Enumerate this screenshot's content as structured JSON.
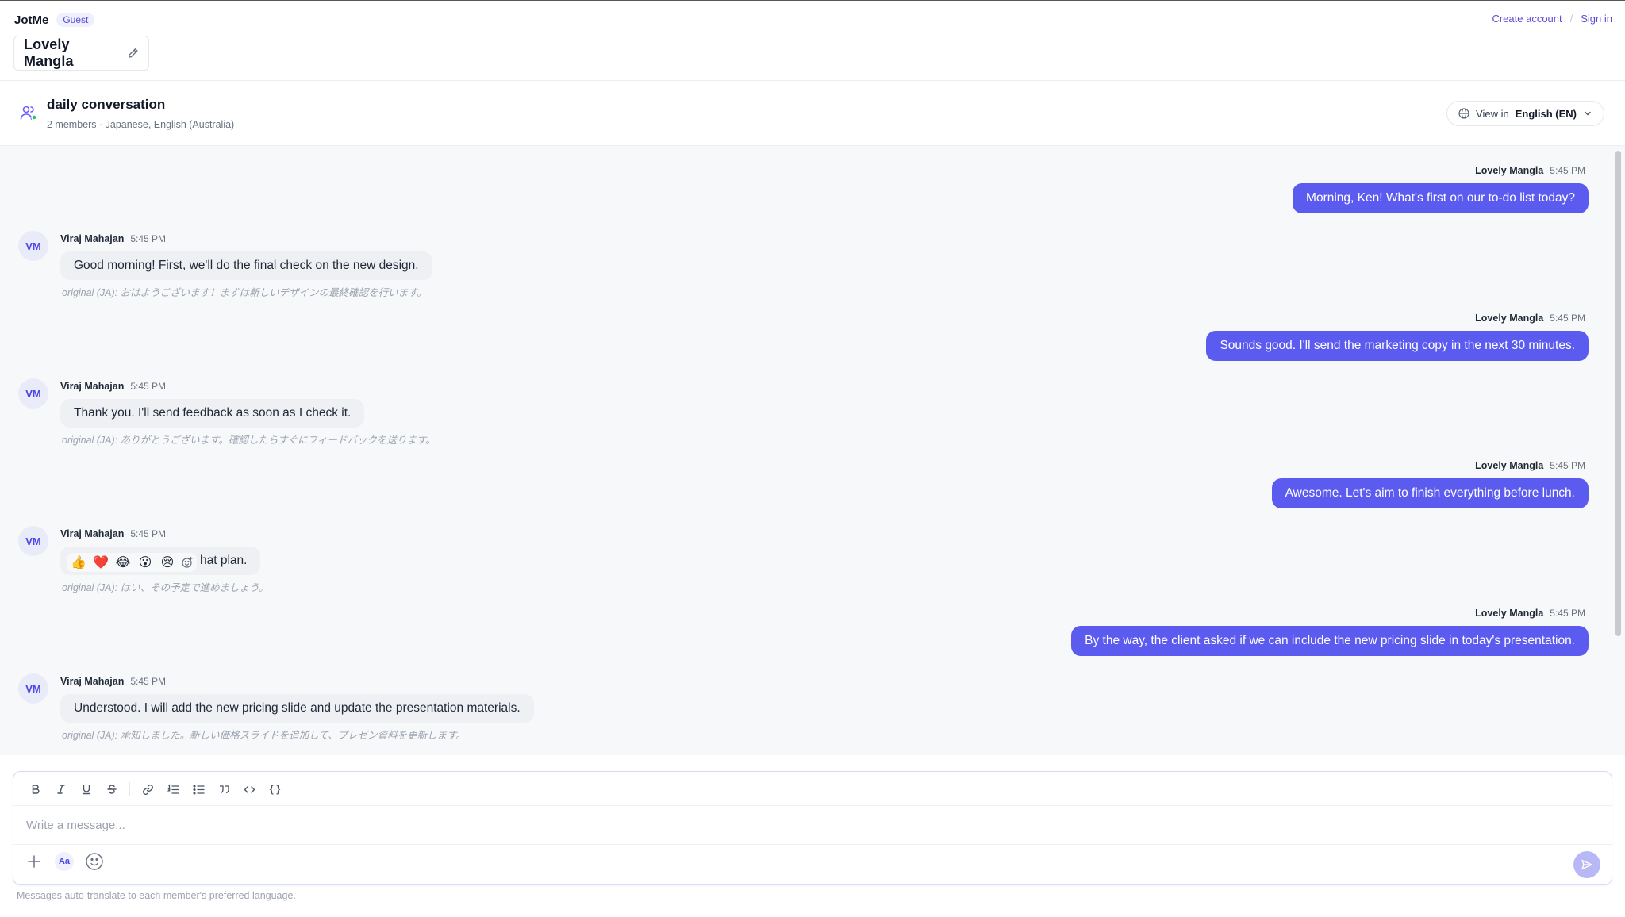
{
  "app": {
    "name": "JotMe",
    "badge": "Guest"
  },
  "top_links": {
    "create_account": "Create account",
    "separator": "/",
    "sign_in": "Sign in"
  },
  "user": {
    "display_name": "Lovely Mangla"
  },
  "conversation": {
    "title": "daily conversation",
    "meta": "2 members · Japanese, English (Australia)",
    "view_in_label": "View in",
    "view_in_language": "English (EN)"
  },
  "messages": [
    {
      "side": "out",
      "author": "Lovely Mangla",
      "time": "5:45 PM",
      "text": "Morning, Ken! What's first on our to-do list today?"
    },
    {
      "side": "in",
      "initials": "VM",
      "author": "Viraj Mahajan",
      "time": "5:45 PM",
      "text": "Good morning! First, we'll do the final check on the new design.",
      "original": "original (JA): おはようございます！まずは新しいデザインの最終確認を行います。"
    },
    {
      "side": "out",
      "author": "Lovely Mangla",
      "time": "5:45 PM",
      "text": "Sounds good. I'll send the marketing copy in the next 30 minutes."
    },
    {
      "side": "in",
      "initials": "VM",
      "author": "Viraj Mahajan",
      "time": "5:45 PM",
      "text": "Thank you. I'll send feedback as soon as I check it.",
      "original": "original (JA): ありがとうございます。確認したらすぐにフィードバックを送ります。"
    },
    {
      "side": "out",
      "author": "Lovely Mangla",
      "time": "5:45 PM",
      "text": "Awesome. Let's aim to finish everything before lunch."
    },
    {
      "side": "in",
      "initials": "VM",
      "author": "Viraj Mahajan",
      "time": "5:45 PM",
      "text": "hat plan.",
      "original": "original (JA): はい、その予定で進めましょう。"
    },
    {
      "side": "out",
      "author": "Lovely Mangla",
      "time": "5:45 PM",
      "text": "By the way, the client asked if we can include the new pricing slide in today's presentation."
    },
    {
      "side": "in",
      "initials": "VM",
      "author": "Viraj Mahajan",
      "time": "5:45 PM",
      "text": "Understood. I will add the new pricing slide and update the presentation materials.",
      "original": "original (JA): 承知しました。新しい価格スライドを追加して、プレゼン資料を更新します。"
    }
  ],
  "reactions": [
    "👍",
    "❤️",
    "😂",
    "😮",
    "😢"
  ],
  "composer": {
    "placeholder": "Write a message...",
    "aa_label": "Aa",
    "toolbar_icons": [
      "bold-icon",
      "italic-icon",
      "underline-icon",
      "strikethrough-icon",
      "link-icon",
      "ordered-list-icon",
      "bullet-list-icon",
      "quote-icon",
      "code-icon",
      "code-block-icon"
    ]
  },
  "footer_note": "Messages auto-translate to each member's preferred language.",
  "colors": {
    "accent": "#5b5bf0",
    "brand_text": "#5b4bd6",
    "background": "#f7f8fa"
  }
}
